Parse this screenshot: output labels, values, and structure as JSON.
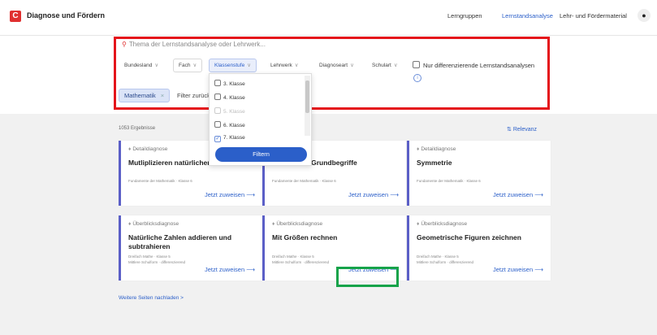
{
  "header": {
    "logo": "C",
    "title": "Diagnose und Fördern",
    "nav": [
      "Lerngruppen",
      "Lernstandsanalyse",
      "Lehr- und Fördermaterial"
    ],
    "avatar_icon": "user-icon"
  },
  "filters": {
    "search_placeholder": "Thema der Lernstandsanalyse oder Lehrwerk...",
    "dropdowns": [
      "Bundesland",
      "Fach",
      "Klassenstufe",
      "Lehrwerk",
      "Diagnoseart",
      "Schulart"
    ],
    "open_dropdown": "Klassenstufe",
    "checkbox_label": "Nur differenzierende Lernstandsanalysen",
    "active_chip": "Mathematik",
    "reset_label": "Filter zurück"
  },
  "dropdown": {
    "items": [
      {
        "label": "3. Klasse",
        "checked": false
      },
      {
        "label": "4. Klasse",
        "checked": false
      },
      {
        "label": "5. Klasse",
        "checked": false
      },
      {
        "label": "6. Klasse",
        "checked": false
      },
      {
        "label": "7. Klasse",
        "checked": true
      }
    ],
    "button": "Filtern"
  },
  "results": {
    "count": "1053 Ergebnisse",
    "sort": "Relevanz",
    "more": "Weitere Seiten nachladen >",
    "assign_label": "Jetzt zuweisen",
    "cards": [
      {
        "type": "Detaildiagnose",
        "title": "Mutliplizieren natürlicher Z",
        "meta": [
          "Fundamente der Mathematik · Klasse 6"
        ]
      },
      {
        "type": "se",
        "title": "e Grundbegriffe",
        "meta": [
          "Fundamente der Mathematik · Klasse 6"
        ]
      },
      {
        "type": "Detaildiagnose",
        "title": "Symmetrie",
        "meta": [
          "Fundamente der Mathematik · Klasse 6"
        ]
      },
      {
        "type": "Überblicksdiagnose",
        "title": "Natürliche Zahlen addieren und subtrahieren",
        "meta": [
          "Dreifach Mathe · Klasse 5",
          "Mittlere Schulform · differenzierend"
        ]
      },
      {
        "type": "Überblicksdiagnose",
        "title": "Mit Größen rechnen",
        "meta": [
          "Dreifach Mathe · Klasse 5",
          "Mittlere Schulform · differenzierend"
        ]
      },
      {
        "type": "Überblicksdiagnose",
        "title": "Geometrische Figuren zeichnen",
        "meta": [
          "Dreifach Mathe · Klasse 5",
          "Mittlere Schulform · differenzierend"
        ]
      }
    ]
  }
}
